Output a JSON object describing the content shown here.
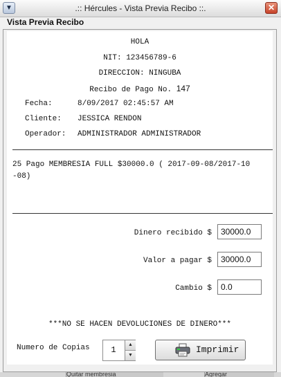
{
  "window": {
    "title": ".:: Hércules - Vista Previa Recibo ::.",
    "menu_glyph": "▼",
    "close_glyph": "✕"
  },
  "panel": {
    "title": "Vista Previa Recibo"
  },
  "receipt": {
    "greeting": "HOLA",
    "nit": "NIT: 123456789-6",
    "direccion": "DIRECCION: NINGUBA",
    "recibo_label": "Recibo de Pago No.",
    "recibo_numero": "147",
    "fecha_label": "Fecha:",
    "fecha_value": "8/09/2017 02:45:57 AM",
    "cliente_label": "Cliente:",
    "cliente_value": "JESSICA RENDON",
    "operador_label": "Operador:",
    "operador_value": "ADMINISTRADOR ADMINISTRADOR",
    "item_line_1": "25 Pago MEMBRESIA FULL $30000.0 ( 2017-09-08/2017-10",
    "item_line_2": "-08)",
    "dinero_label": "Dinero recibido $",
    "dinero_value": "30000.0",
    "valor_label": "Valor a pagar $",
    "valor_value": "30000.0",
    "cambio_label": "Cambio $",
    "cambio_value": "0.0",
    "footer_notice": "***NO SE HACEN DEVOLUCIONES DE DINERO***",
    "copias_label": "Numero de Copias",
    "copias_value": "1",
    "print_label": "Imprimir"
  },
  "taskbar": {
    "item_a": "Quitar membresia",
    "item_b": "Agregar"
  },
  "icons": [
    "window-menu-icon",
    "close-icon",
    "printer-icon",
    "spinner-up-icon",
    "spinner-down-icon"
  ]
}
